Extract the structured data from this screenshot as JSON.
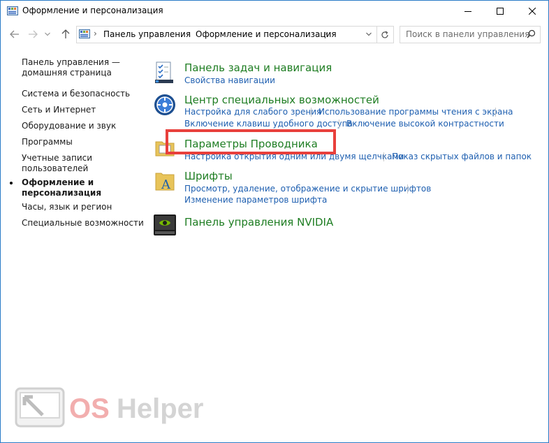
{
  "window": {
    "title": "Оформление и персонализация"
  },
  "nav": {
    "breadcrumbs": [
      "Панель управления",
      "Оформление и персонализация"
    ],
    "search_placeholder": "Поиск в панели управления"
  },
  "sidebar": {
    "home_line1": "Панель управления —",
    "home_line2": "домашняя страница",
    "items": [
      {
        "label": "Система и безопасность"
      },
      {
        "label": "Сеть и Интернет"
      },
      {
        "label": "Оборудование и звук"
      },
      {
        "label": "Программы"
      },
      {
        "label": "Учетные записи",
        "label2": "пользователей"
      },
      {
        "label": "Оформление и",
        "label2": "персонализация"
      },
      {
        "label": "Часы, язык и регион"
      },
      {
        "label": "Специальные возможности"
      }
    ]
  },
  "categories": [
    {
      "title": "Панель задач и навигация",
      "links": [
        "Свойства навигации"
      ],
      "icon": "taskbar-checklist-icon"
    },
    {
      "title": "Центр специальных возможностей",
      "links": [
        "Настройка для слабого зрения",
        "Использование программы чтения с экрана",
        "Включение клавиш удобного доступа",
        "Включение высокой контрастности"
      ],
      "icon": "ease-of-access-icon"
    },
    {
      "title": "Параметры Проводника",
      "links": [
        "Настройка открытия одним или двумя щелчками",
        "Показ скрытых файлов и папок"
      ],
      "icon": "folder-options-icon"
    },
    {
      "title": "Шрифты",
      "links": [
        "Просмотр, удаление, отображение и скрытие шрифтов",
        "Изменение параметров шрифта"
      ],
      "icon": "fonts-folder-icon"
    },
    {
      "title": "Панель управления NVIDIA",
      "links": [],
      "icon": "nvidia-icon"
    }
  ],
  "watermark": {
    "text": "OS Helper"
  },
  "colors": {
    "category_title": "#1e7d22",
    "link": "#1e5fb0",
    "highlight": "#e8403c",
    "window_border": "#2a7bc7"
  }
}
